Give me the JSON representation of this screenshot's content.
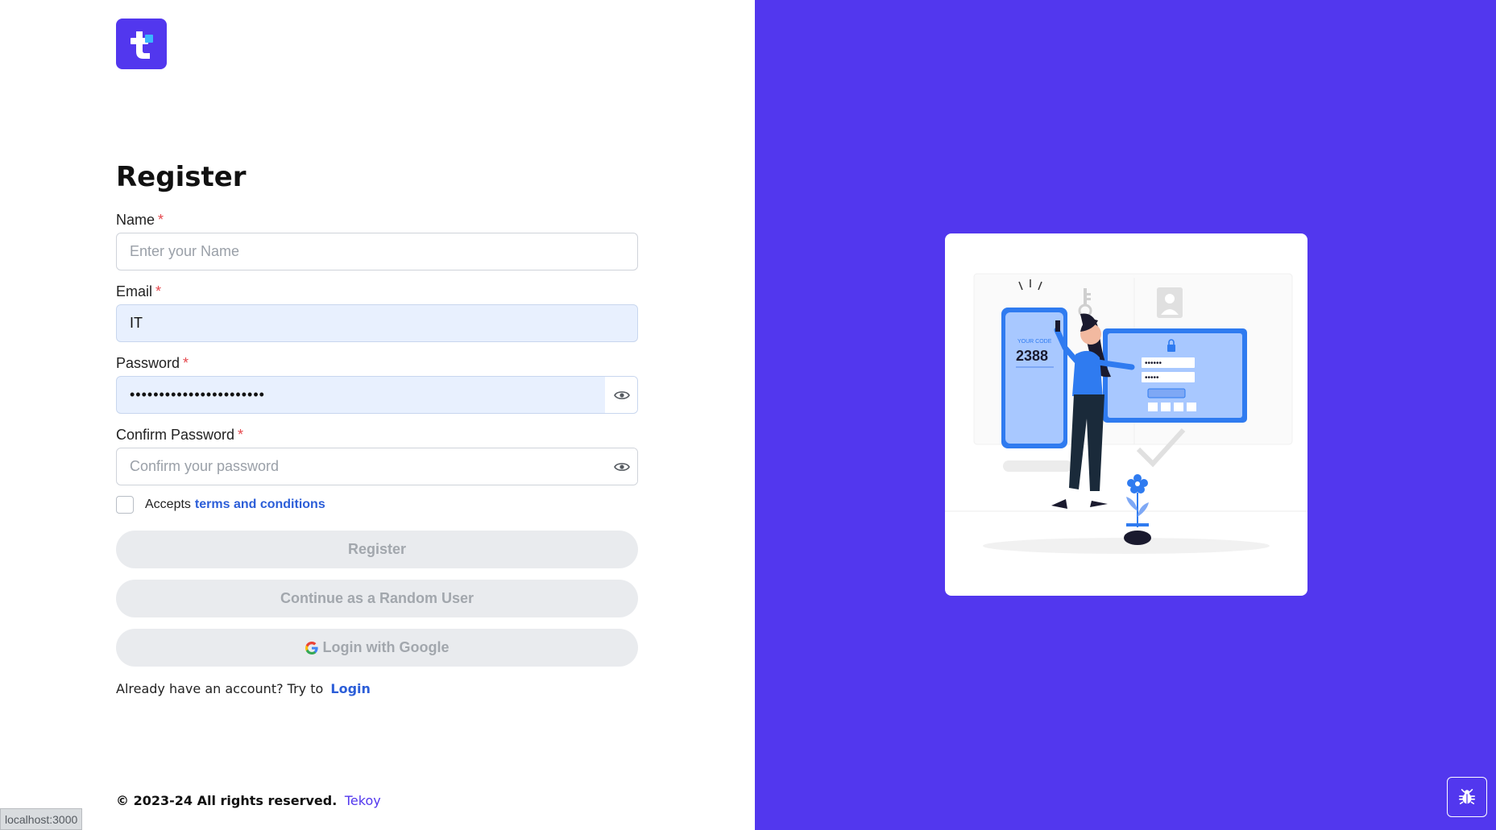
{
  "brand": {
    "logo_icon": "tekoy-logo-icon",
    "accent": "#5237ee"
  },
  "form": {
    "title": "Register",
    "name": {
      "label": "Name",
      "required": "*",
      "placeholder": "Enter your Name",
      "value": ""
    },
    "email": {
      "label": "Email",
      "required": "*",
      "placeholder": "",
      "value": "IT"
    },
    "password": {
      "label": "Password",
      "required": "*",
      "value": "•••••••••••••••••••••••",
      "toggle_icon": "eye-icon"
    },
    "confirm_password": {
      "label": "Confirm Password",
      "required": "*",
      "placeholder": "Confirm your password",
      "value": "",
      "toggle_icon": "eye-icon"
    },
    "terms": {
      "prefix": "Accepts",
      "link": "terms and conditions",
      "checked": false
    },
    "buttons": {
      "register": "Register",
      "random_user": "Continue as a Random User",
      "google": "Login with Google"
    },
    "already": {
      "text": "Already have an account? Try to",
      "link": "Login"
    }
  },
  "footer": {
    "text": "© 2023-24 All rights reserved.",
    "brand": "Tekoy"
  },
  "status_bar": {
    "url": "localhost:3000"
  },
  "illustration": {
    "code_label": "YOUR CODE",
    "code": "2388",
    "pw1": "••••••",
    "pw2": "•••••"
  },
  "colors": {
    "panel": "#5237ee",
    "link": "#2c5ed8",
    "required": "#e5484d",
    "autofill": "#e8f0fe",
    "button_disabled": "#e9ebee"
  }
}
